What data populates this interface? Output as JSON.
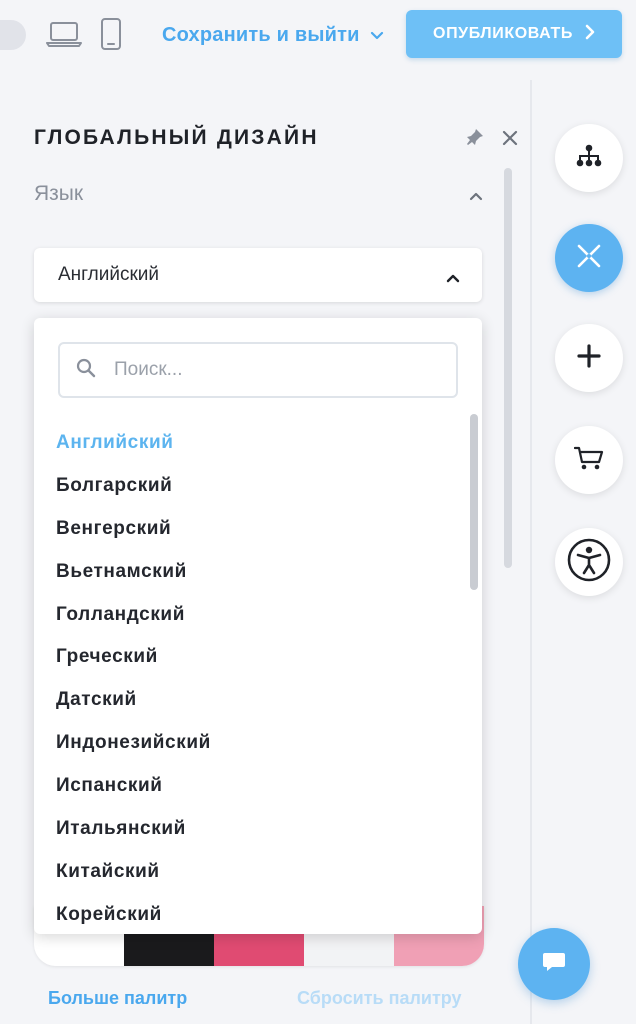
{
  "topbar": {
    "save_exit_label": "Сохранить и выйти",
    "publish_label": "ОПУБЛИКОВАТЬ",
    "devices": [
      "laptop-icon",
      "mobile-phone-icon"
    ]
  },
  "panel": {
    "title": "ГЛОБАЛЬНЫЙ ДИЗАЙН",
    "section_label": "Язык",
    "language_select": {
      "selected_value": "Английский",
      "search_placeholder": "Поиск..."
    },
    "languages": [
      {
        "label": "Английский",
        "selected": true
      },
      {
        "label": "Болгарский",
        "selected": false
      },
      {
        "label": "Венгерский",
        "selected": false
      },
      {
        "label": "Вьетнамский",
        "selected": false
      },
      {
        "label": "Голландский",
        "selected": false
      },
      {
        "label": "Греческий",
        "selected": false
      },
      {
        "label": "Датский",
        "selected": false
      },
      {
        "label": "Индонезийский",
        "selected": false
      },
      {
        "label": "Испанский",
        "selected": false
      },
      {
        "label": "Итальянский",
        "selected": false
      },
      {
        "label": "Китайский",
        "selected": false
      },
      {
        "label": "Корейский",
        "selected": false
      }
    ],
    "palette_swatches": [
      "#ffffff",
      "#1a1a1c",
      "#e04b72",
      "#f2f3f5",
      "#f0a0b5"
    ],
    "more_palettes_label": "Больше палитр",
    "reset_palette_label": "Сбросить палитру"
  },
  "rail": {
    "buttons": [
      "sitemap-icon",
      "close-x-icon",
      "plus-icon",
      "cart-icon",
      "accessibility-icon"
    ],
    "active_button": "close-x-icon"
  },
  "colors": {
    "accent": "#5db3f1",
    "link": "#4aa8ee",
    "publish_bg": "#6ec0f6",
    "background": "#f4f5f8"
  }
}
